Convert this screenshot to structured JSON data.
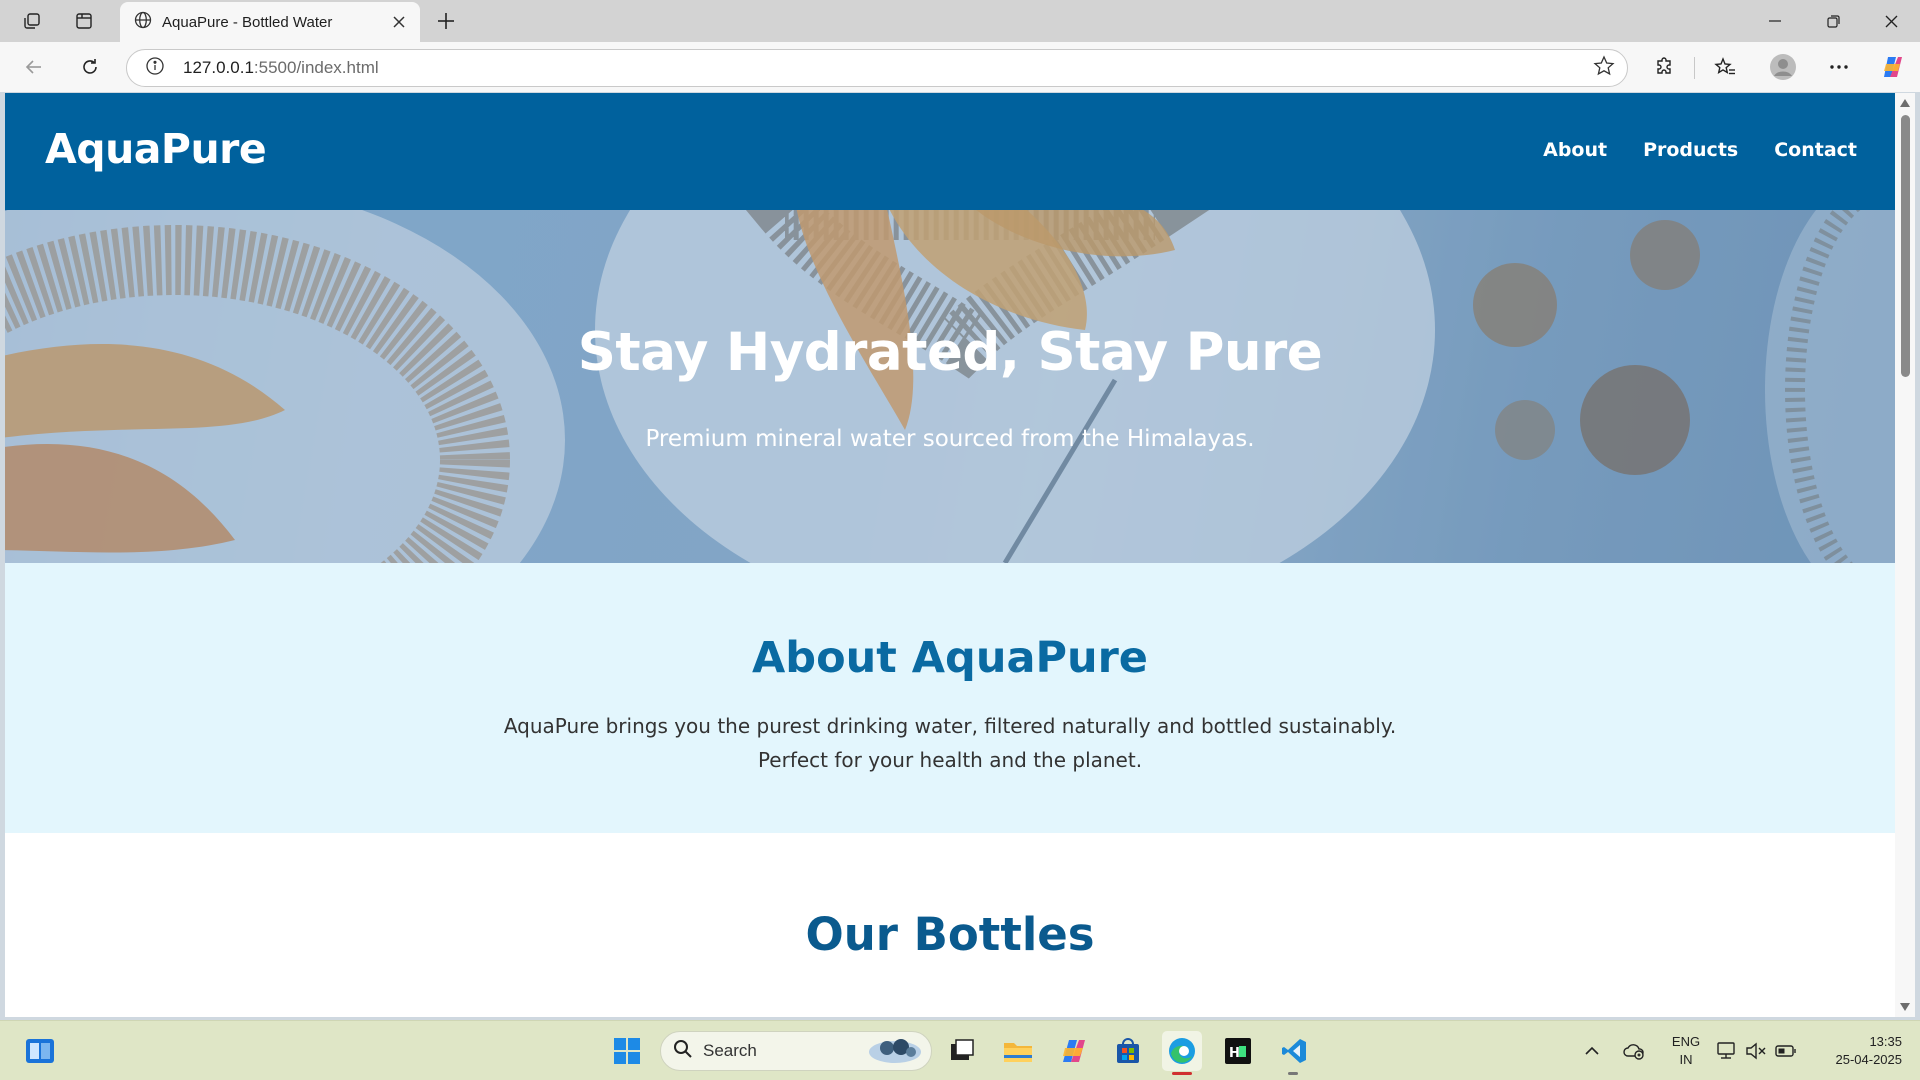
{
  "browser": {
    "tab_title": "AquaPure - Bottled Water",
    "url_host": "127.0.0.1",
    "url_path": ":5500/index.html"
  },
  "site": {
    "logo": "AquaPure",
    "nav": [
      {
        "label": "About"
      },
      {
        "label": "Products"
      },
      {
        "label": "Contact"
      }
    ],
    "hero": {
      "title": "Stay Hydrated, Stay Pure",
      "subtitle": "Premium mineral water sourced from the Himalayas."
    },
    "about": {
      "title": "About AquaPure",
      "text": "AquaPure brings you the purest drinking water, filtered naturally and bottled sustainably. Perfect for your health and the planet."
    },
    "bottles": {
      "title": "Our Bottles"
    }
  },
  "taskbar": {
    "search_label": "Search",
    "lang_line1": "ENG",
    "lang_line2": "IN",
    "time": "13:35",
    "date": "25-04-2025"
  },
  "colors": {
    "header_bg": "#00619d",
    "about_bg": "#e3f6fd",
    "about_title": "#0a6aa2",
    "bottles_title": "#0a5a8e"
  }
}
